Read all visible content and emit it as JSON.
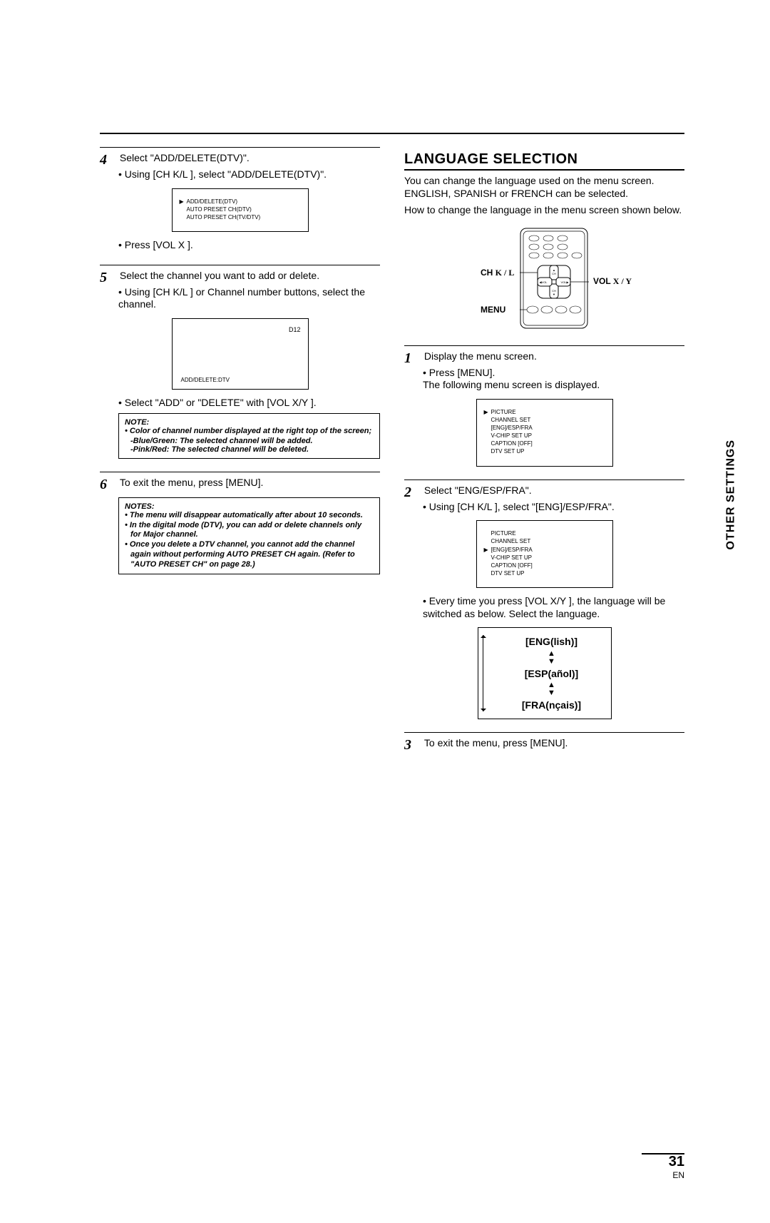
{
  "side_tab": "OTHER SETTINGS",
  "left": {
    "step4": {
      "num": "4",
      "text": "Select \"ADD/DELETE(DTV)\".",
      "bullet": "Using [CH K/L ], select \"ADD/DELETE(DTV)\".",
      "diag": {
        "line1": "ADD/DELETE(DTV)",
        "line2": "AUTO PRESET CH(DTV)",
        "line3": "AUTO PRESET CH(TV/DTV)"
      },
      "press": "Press [VOL X ]."
    },
    "step5": {
      "num": "5",
      "text": "Select the channel you want to add or delete.",
      "bullet": "Using [CH K/L ] or Channel number buttons, select the channel.",
      "d12": "D12",
      "adddel": "ADD/DELETE:DTV",
      "selectaddel": "Select \"ADD\" or \"DELETE\" with [VOL X/Y ].",
      "note_title": "NOTE:",
      "note_item": "Color of channel number displayed at the right top of the screen;",
      "note_sub1": "-Blue/Green: The selected channel will be added.",
      "note_sub2": "-Pink/Red: The selected channel will be deleted."
    },
    "step6": {
      "num": "6",
      "text": "To exit the menu, press [MENU].",
      "notes_title": "NOTES:",
      "n1": "The menu will disappear automatically after about 10 seconds.",
      "n2": "In the digital mode (DTV), you can add or delete channels only for Major channel.",
      "n3": "Once you delete a DTV channel, you cannot add the channel again without performing AUTO PRESET CH again. (Refer to \"AUTO PRESET CH\" on page 28.)"
    }
  },
  "right": {
    "title": "LANGUAGE SELECTION",
    "intro1": "You can change the language used on the menu screen. ENGLISH, SPANISH or FRENCH can be selected.",
    "intro2": "How to change the language in the menu screen shown below.",
    "remote_labels": {
      "ch": "CH K/L",
      "menu": "MENU",
      "vol": "VOL X / Y"
    },
    "step1": {
      "num": "1",
      "text": "Display the menu screen.",
      "bullet": "Press [MENU].",
      "sub": "The following menu screen is displayed.",
      "diag": {
        "l1": "PICTURE",
        "l2": "CHANNEL SET",
        "l3": "[ENG]/ESP/FRA",
        "l4": "V-CHIP SET UP",
        "l5": "CAPTION [OFF]",
        "l6": "DTV SET UP"
      }
    },
    "step2": {
      "num": "2",
      "text": "Select \"ENG/ESP/FRA\".",
      "bullet": "Using [CH K/L ], select \"[ENG]/ESP/FRA\".",
      "diag": {
        "l1": "PICTURE",
        "l2": "CHANNEL SET",
        "l3": "[ENG]/ESP/FRA",
        "l4": "V-CHIP SET UP",
        "l5": "CAPTION [OFF]",
        "l6": "DTV SET UP"
      },
      "every": "Every time you press [VOL X/Y ], the language will be switched as below. Select the language.",
      "cycle": {
        "a": "[ENG(lish)]",
        "b": "[ESP(añol)]",
        "c": "[FRA(nçais)]"
      }
    },
    "step3": {
      "num": "3",
      "text": "To exit the menu, press [MENU]."
    }
  },
  "page_number": "31",
  "page_lang": "EN"
}
